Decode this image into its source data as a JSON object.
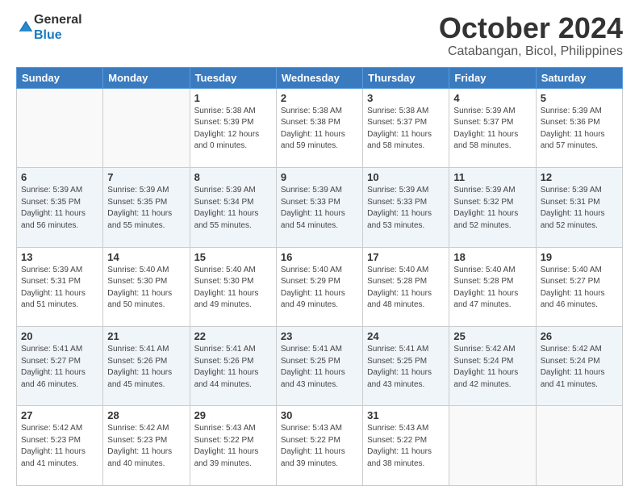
{
  "logo": {
    "general": "General",
    "blue": "Blue"
  },
  "title": "October 2024",
  "subtitle": "Catabangan, Bicol, Philippines",
  "days_of_week": [
    "Sunday",
    "Monday",
    "Tuesday",
    "Wednesday",
    "Thursday",
    "Friday",
    "Saturday"
  ],
  "weeks": [
    [
      {
        "day": "",
        "info": ""
      },
      {
        "day": "",
        "info": ""
      },
      {
        "day": "1",
        "info": "Sunrise: 5:38 AM\nSunset: 5:39 PM\nDaylight: 12 hours and 0 minutes."
      },
      {
        "day": "2",
        "info": "Sunrise: 5:38 AM\nSunset: 5:38 PM\nDaylight: 11 hours and 59 minutes."
      },
      {
        "day": "3",
        "info": "Sunrise: 5:38 AM\nSunset: 5:37 PM\nDaylight: 11 hours and 58 minutes."
      },
      {
        "day": "4",
        "info": "Sunrise: 5:39 AM\nSunset: 5:37 PM\nDaylight: 11 hours and 58 minutes."
      },
      {
        "day": "5",
        "info": "Sunrise: 5:39 AM\nSunset: 5:36 PM\nDaylight: 11 hours and 57 minutes."
      }
    ],
    [
      {
        "day": "6",
        "info": "Sunrise: 5:39 AM\nSunset: 5:35 PM\nDaylight: 11 hours and 56 minutes."
      },
      {
        "day": "7",
        "info": "Sunrise: 5:39 AM\nSunset: 5:35 PM\nDaylight: 11 hours and 55 minutes."
      },
      {
        "day": "8",
        "info": "Sunrise: 5:39 AM\nSunset: 5:34 PM\nDaylight: 11 hours and 55 minutes."
      },
      {
        "day": "9",
        "info": "Sunrise: 5:39 AM\nSunset: 5:33 PM\nDaylight: 11 hours and 54 minutes."
      },
      {
        "day": "10",
        "info": "Sunrise: 5:39 AM\nSunset: 5:33 PM\nDaylight: 11 hours and 53 minutes."
      },
      {
        "day": "11",
        "info": "Sunrise: 5:39 AM\nSunset: 5:32 PM\nDaylight: 11 hours and 52 minutes."
      },
      {
        "day": "12",
        "info": "Sunrise: 5:39 AM\nSunset: 5:31 PM\nDaylight: 11 hours and 52 minutes."
      }
    ],
    [
      {
        "day": "13",
        "info": "Sunrise: 5:39 AM\nSunset: 5:31 PM\nDaylight: 11 hours and 51 minutes."
      },
      {
        "day": "14",
        "info": "Sunrise: 5:40 AM\nSunset: 5:30 PM\nDaylight: 11 hours and 50 minutes."
      },
      {
        "day": "15",
        "info": "Sunrise: 5:40 AM\nSunset: 5:30 PM\nDaylight: 11 hours and 49 minutes."
      },
      {
        "day": "16",
        "info": "Sunrise: 5:40 AM\nSunset: 5:29 PM\nDaylight: 11 hours and 49 minutes."
      },
      {
        "day": "17",
        "info": "Sunrise: 5:40 AM\nSunset: 5:28 PM\nDaylight: 11 hours and 48 minutes."
      },
      {
        "day": "18",
        "info": "Sunrise: 5:40 AM\nSunset: 5:28 PM\nDaylight: 11 hours and 47 minutes."
      },
      {
        "day": "19",
        "info": "Sunrise: 5:40 AM\nSunset: 5:27 PM\nDaylight: 11 hours and 46 minutes."
      }
    ],
    [
      {
        "day": "20",
        "info": "Sunrise: 5:41 AM\nSunset: 5:27 PM\nDaylight: 11 hours and 46 minutes."
      },
      {
        "day": "21",
        "info": "Sunrise: 5:41 AM\nSunset: 5:26 PM\nDaylight: 11 hours and 45 minutes."
      },
      {
        "day": "22",
        "info": "Sunrise: 5:41 AM\nSunset: 5:26 PM\nDaylight: 11 hours and 44 minutes."
      },
      {
        "day": "23",
        "info": "Sunrise: 5:41 AM\nSunset: 5:25 PM\nDaylight: 11 hours and 43 minutes."
      },
      {
        "day": "24",
        "info": "Sunrise: 5:41 AM\nSunset: 5:25 PM\nDaylight: 11 hours and 43 minutes."
      },
      {
        "day": "25",
        "info": "Sunrise: 5:42 AM\nSunset: 5:24 PM\nDaylight: 11 hours and 42 minutes."
      },
      {
        "day": "26",
        "info": "Sunrise: 5:42 AM\nSunset: 5:24 PM\nDaylight: 11 hours and 41 minutes."
      }
    ],
    [
      {
        "day": "27",
        "info": "Sunrise: 5:42 AM\nSunset: 5:23 PM\nDaylight: 11 hours and 41 minutes."
      },
      {
        "day": "28",
        "info": "Sunrise: 5:42 AM\nSunset: 5:23 PM\nDaylight: 11 hours and 40 minutes."
      },
      {
        "day": "29",
        "info": "Sunrise: 5:43 AM\nSunset: 5:22 PM\nDaylight: 11 hours and 39 minutes."
      },
      {
        "day": "30",
        "info": "Sunrise: 5:43 AM\nSunset: 5:22 PM\nDaylight: 11 hours and 39 minutes."
      },
      {
        "day": "31",
        "info": "Sunrise: 5:43 AM\nSunset: 5:22 PM\nDaylight: 11 hours and 38 minutes."
      },
      {
        "day": "",
        "info": ""
      },
      {
        "day": "",
        "info": ""
      }
    ]
  ]
}
